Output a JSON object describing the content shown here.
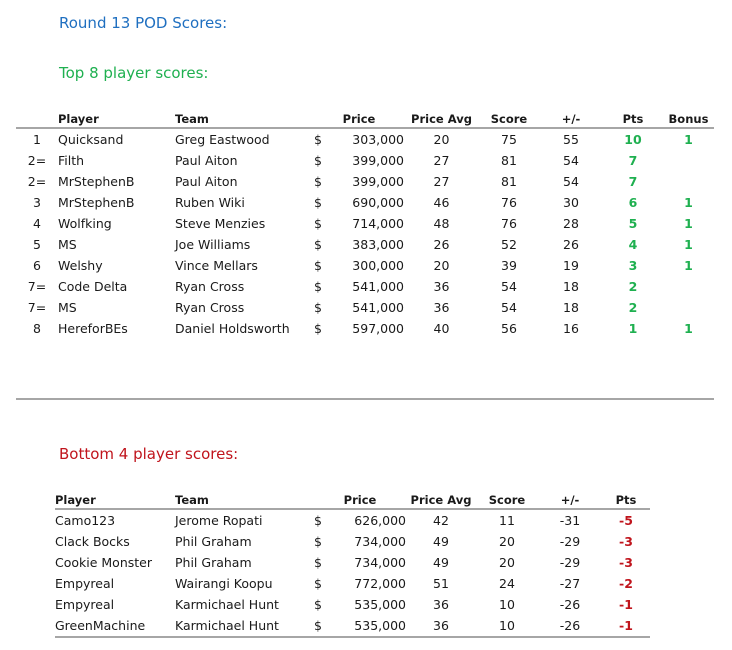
{
  "colors": {
    "title": "#1f6fc0",
    "top_heading": "#1fb050",
    "bottom_heading": "#c0141c",
    "positive_pts": "#1fb050",
    "negative_pts": "#c0141c",
    "rule": "#a6a6a6"
  },
  "title": "Round 13 POD Scores:",
  "top": {
    "heading": "Top 8 player scores:",
    "columns": {
      "rank": "",
      "player": "Player",
      "team": "Team",
      "price": "Price",
      "price_avg": "Price Avg",
      "score": "Score",
      "diff": "+/-",
      "pts": "Pts",
      "bonus": "Bonus"
    },
    "rows": [
      {
        "rank": "1",
        "player": "Quicksand",
        "team": "Greg Eastwood",
        "currency": "$",
        "price": "303,000",
        "price_avg": "20",
        "score": "75",
        "diff": "55",
        "pts": "10",
        "bonus": "1"
      },
      {
        "rank": "2=",
        "player": "Filth",
        "team": "Paul Aiton",
        "currency": "$",
        "price": "399,000",
        "price_avg": "27",
        "score": "81",
        "diff": "54",
        "pts": "7",
        "bonus": ""
      },
      {
        "rank": "2=",
        "player": "MrStephenB",
        "team": "Paul Aiton",
        "currency": "$",
        "price": "399,000",
        "price_avg": "27",
        "score": "81",
        "diff": "54",
        "pts": "7",
        "bonus": ""
      },
      {
        "rank": "3",
        "player": "MrStephenB",
        "team": "Ruben Wiki",
        "currency": "$",
        "price": "690,000",
        "price_avg": "46",
        "score": "76",
        "diff": "30",
        "pts": "6",
        "bonus": "1"
      },
      {
        "rank": "4",
        "player": "Wolfking",
        "team": "Steve Menzies",
        "currency": "$",
        "price": "714,000",
        "price_avg": "48",
        "score": "76",
        "diff": "28",
        "pts": "5",
        "bonus": "1"
      },
      {
        "rank": "5",
        "player": "MS",
        "team": "Joe Williams",
        "currency": "$",
        "price": "383,000",
        "price_avg": "26",
        "score": "52",
        "diff": "26",
        "pts": "4",
        "bonus": "1"
      },
      {
        "rank": "6",
        "player": "Welshy",
        "team": "Vince Mellars",
        "currency": "$",
        "price": "300,000",
        "price_avg": "20",
        "score": "39",
        "diff": "19",
        "pts": "3",
        "bonus": "1"
      },
      {
        "rank": "7=",
        "player": "Code Delta",
        "team": "Ryan Cross",
        "currency": "$",
        "price": "541,000",
        "price_avg": "36",
        "score": "54",
        "diff": "18",
        "pts": "2",
        "bonus": ""
      },
      {
        "rank": "7=",
        "player": "MS",
        "team": "Ryan Cross",
        "currency": "$",
        "price": "541,000",
        "price_avg": "36",
        "score": "54",
        "diff": "18",
        "pts": "2",
        "bonus": ""
      },
      {
        "rank": "8",
        "player": "HereforBEs",
        "team": "Daniel Holdsworth",
        "currency": "$",
        "price": "597,000",
        "price_avg": "40",
        "score": "56",
        "diff": "16",
        "pts": "1",
        "bonus": "1"
      }
    ]
  },
  "bottom": {
    "heading": "Bottom 4 player scores:",
    "columns": {
      "player": "Player",
      "team": "Team",
      "price": "Price",
      "price_avg": "Price Avg",
      "score": "Score",
      "diff": "+/-",
      "pts": "Pts"
    },
    "rows": [
      {
        "player": "Camo123",
        "team": "Jerome Ropati",
        "currency": "$",
        "price": "626,000",
        "price_avg": "42",
        "score": "11",
        "diff": "-31",
        "pts": "-5"
      },
      {
        "player": "Clack Bocks",
        "team": "Phil Graham",
        "currency": "$",
        "price": "734,000",
        "price_avg": "49",
        "score": "20",
        "diff": "-29",
        "pts": "-3"
      },
      {
        "player": "Cookie Monster",
        "team": "Phil Graham",
        "currency": "$",
        "price": "734,000",
        "price_avg": "49",
        "score": "20",
        "diff": "-29",
        "pts": "-3"
      },
      {
        "player": "Empyreal",
        "team": "Wairangi Koopu",
        "currency": "$",
        "price": "772,000",
        "price_avg": "51",
        "score": "24",
        "diff": "-27",
        "pts": "-2"
      },
      {
        "player": "Empyreal",
        "team": "Karmichael Hunt",
        "currency": "$",
        "price": "535,000",
        "price_avg": "36",
        "score": "10",
        "diff": "-26",
        "pts": "-1"
      },
      {
        "player": "GreenMachine",
        "team": "Karmichael Hunt",
        "currency": "$",
        "price": "535,000",
        "price_avg": "36",
        "score": "10",
        "diff": "-26",
        "pts": "-1"
      }
    ]
  }
}
